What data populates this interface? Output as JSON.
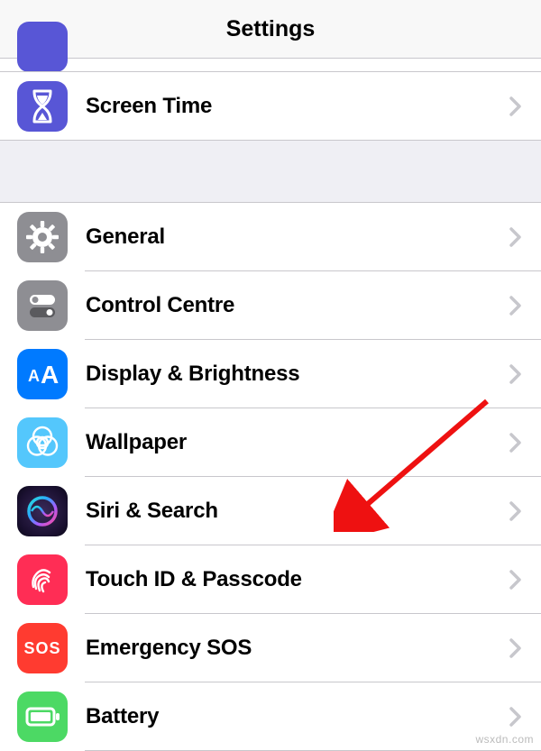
{
  "header": {
    "title": "Settings"
  },
  "group1": [
    {
      "id": "screen-time",
      "label": "Screen Time",
      "icon": "hourglass",
      "bg": "#5856d6"
    }
  ],
  "group2": [
    {
      "id": "general",
      "label": "General",
      "icon": "gear",
      "bg": "#8e8e93"
    },
    {
      "id": "control-centre",
      "label": "Control Centre",
      "icon": "toggles",
      "bg": "#8e8e93"
    },
    {
      "id": "display",
      "label": "Display & Brightness",
      "icon": "aa",
      "bg": "#007aff"
    },
    {
      "id": "wallpaper",
      "label": "Wallpaper",
      "icon": "flower",
      "bg": "#54c7fc"
    },
    {
      "id": "siri",
      "label": "Siri & Search",
      "icon": "siri",
      "bg": "#000000"
    },
    {
      "id": "touchid",
      "label": "Touch ID & Passcode",
      "icon": "fingerprint",
      "bg": "#ff2d55"
    },
    {
      "id": "sos",
      "label": "Emergency SOS",
      "icon": "sos",
      "bg": "#ff3b30"
    },
    {
      "id": "battery",
      "label": "Battery",
      "icon": "battery",
      "bg": "#4cd964"
    }
  ],
  "watermark": "wsxdn.com"
}
